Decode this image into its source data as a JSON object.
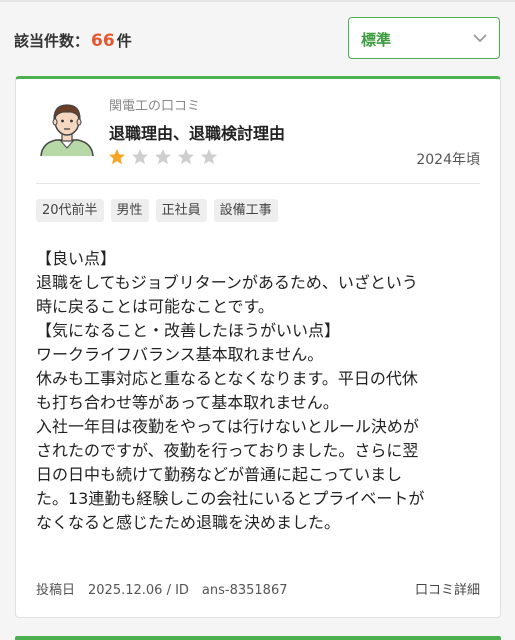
{
  "results": {
    "label": "該当件数：",
    "count": "66",
    "unit": "件"
  },
  "sort": {
    "selected": "標準"
  },
  "review": {
    "source": "関電工の口コミ",
    "title": "退職理由、退職検討理由",
    "rating": 1,
    "rating_max": 5,
    "period": "2024年頃",
    "tags": [
      "20代前半",
      "男性",
      "正社員",
      "設備工事"
    ],
    "body_lines": [
      "【良い点】",
      "退職をしてもジョブリターンがあるため、いざという",
      "時に戻ることは可能なことです。",
      "【気になること・改善したほうがいい点】",
      "ワークライフバランス基本取れません。",
      "休みも工事対応と重なるとなくなります。平日の代休",
      "も打ち合わせ等があって基本取れません。",
      "入社一年目は夜勤をやっては行けないとルール決めが",
      "されたのですが、夜勤を行っておりました。さらに翌",
      "日の日中も続けて勤務などが普通に起こっていまし",
      "た。13連勤も経験しこの会社にいるとプライベートが",
      "なくなると感じたため退職を決めました。"
    ],
    "posted": "投稿日　2025.12.06 / ID　ans-8351867",
    "detail_link": "口コミ詳細"
  },
  "colors": {
    "accent": "#4caf50",
    "count": "#e4572e",
    "star_on": "#f5a623",
    "star_off": "#cfcfcf"
  }
}
